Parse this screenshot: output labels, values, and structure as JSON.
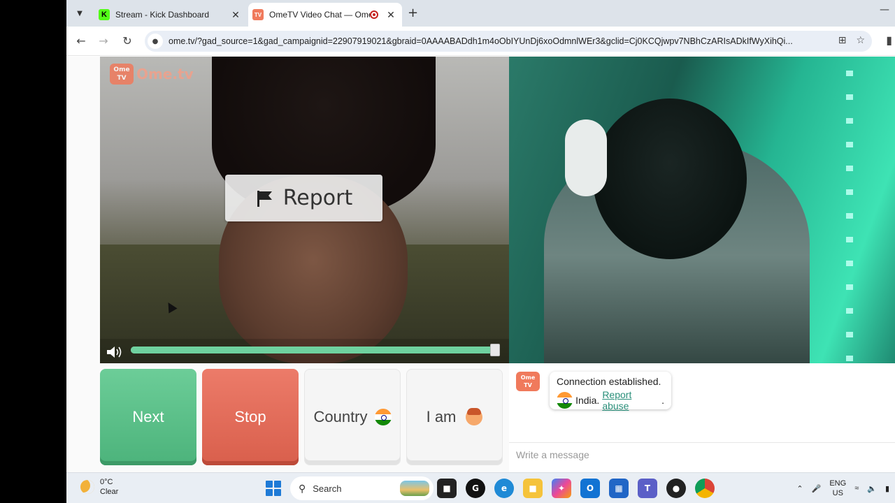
{
  "browser": {
    "tabs": [
      {
        "title": "Stream - Kick Dashboard",
        "favicon": "K",
        "active": false
      },
      {
        "title": "OmeTV Video Chat — Ome",
        "favicon": "ome-tv-icon",
        "active": true,
        "recording": true
      }
    ],
    "url": "ome.tv/?gad_source=1&gad_campaignid=22907919021&gbraid=0AAAABADdh1m4oObIYUnDj6xoOdmnlWEr3&gclid=Cj0KCQjwpv7NBhCzARIsADkIfWyXihQi..."
  },
  "video": {
    "logo_text": "Ome.tv",
    "logo_badge": "Ome TV",
    "report_label": "Report",
    "volume_level": 1.0
  },
  "controls": {
    "next_label": "Next",
    "stop_label": "Stop",
    "country_label": "Country",
    "iam_label": "I am"
  },
  "chat": {
    "logo_badge": "Ome TV",
    "message_line1": "Connection established.",
    "country": "India.",
    "report_link": "Report abuse",
    "period": ".",
    "input_placeholder": "Write a message"
  },
  "taskbar": {
    "temperature": "0°C",
    "condition": "Clear",
    "search_label": "Search",
    "lang_line1": "ENG",
    "lang_line2": "US"
  },
  "colors": {
    "next": "#5cc089",
    "stop": "#e46c59",
    "link": "#2a8f7a",
    "brand": "#f07a5c"
  }
}
